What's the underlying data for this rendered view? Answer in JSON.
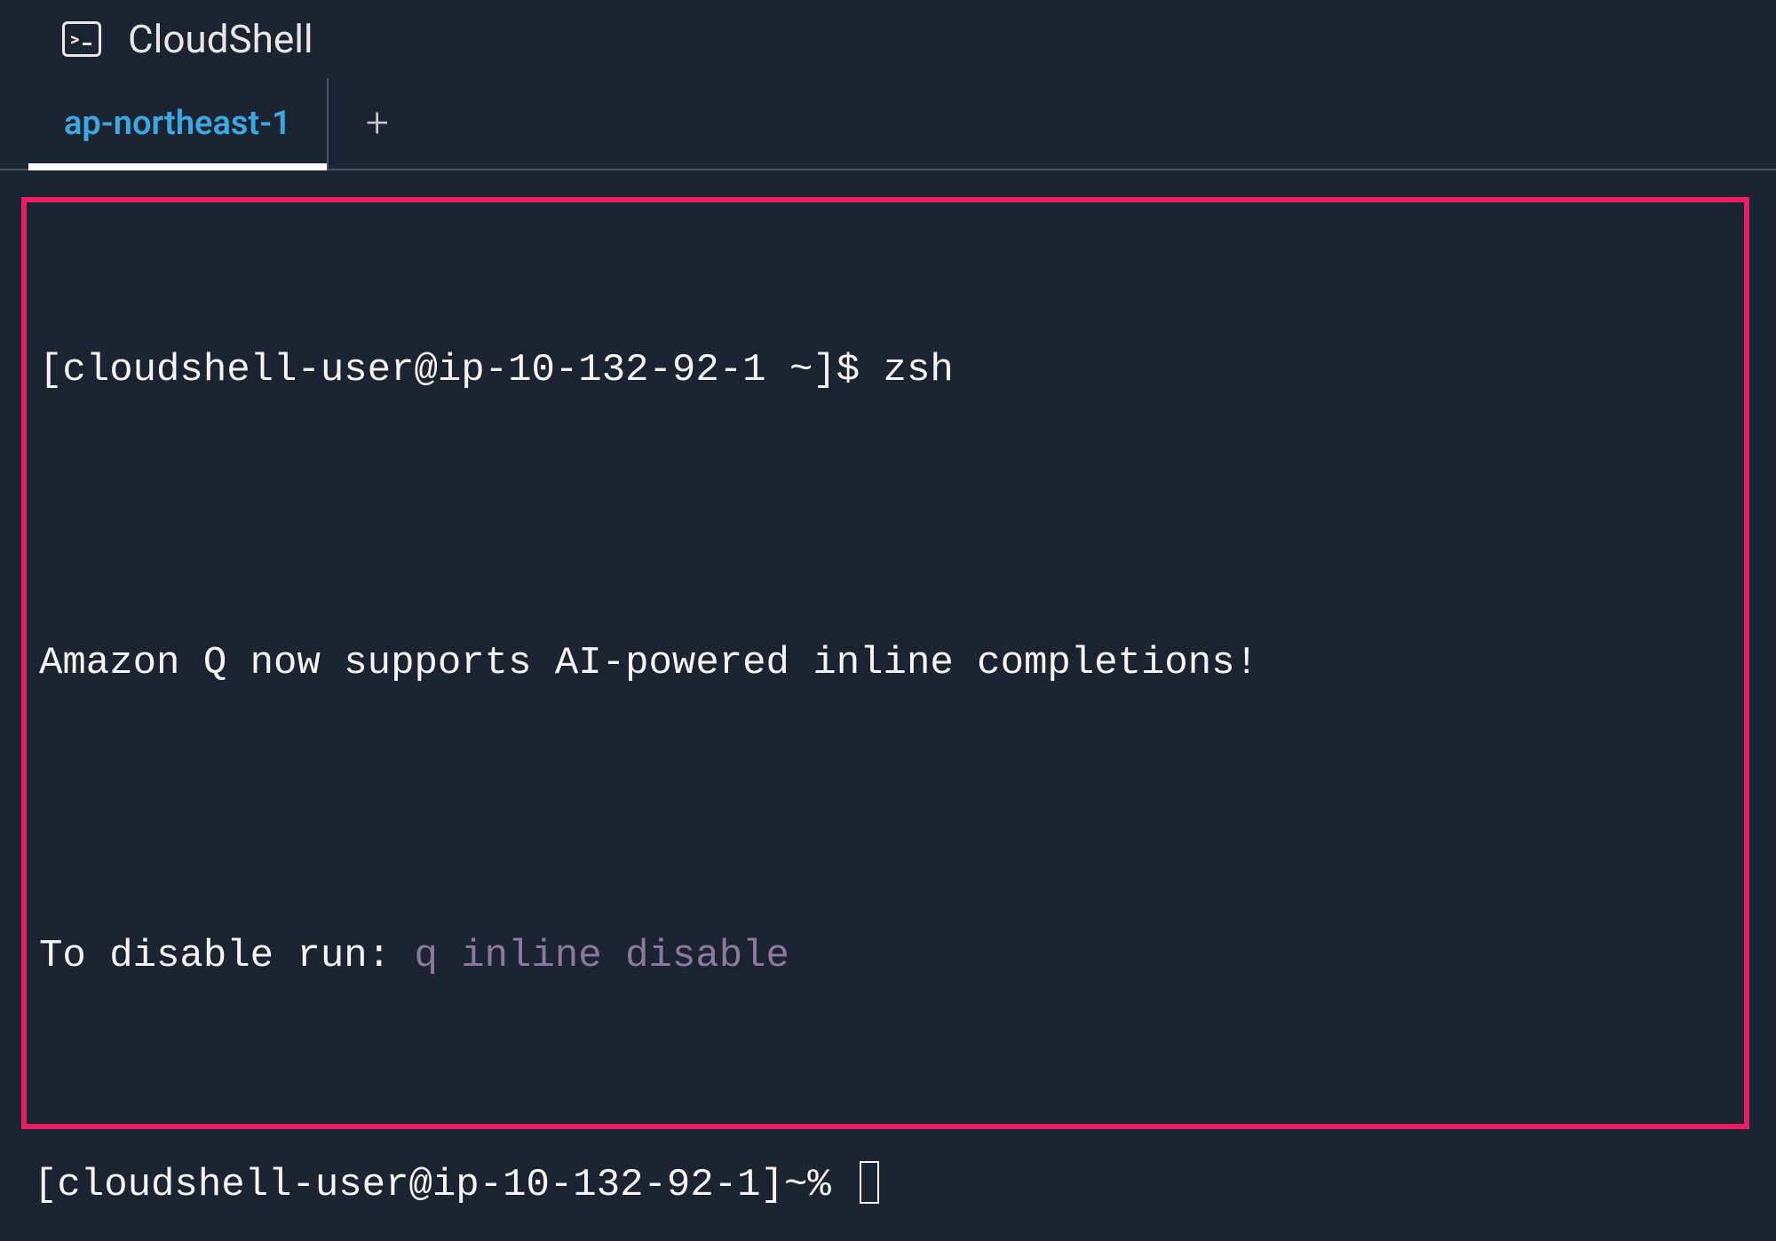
{
  "header": {
    "title": "CloudShell"
  },
  "tabs": {
    "active_label": "ap-northeast-1",
    "add_symbol": "+"
  },
  "terminal": {
    "line1_prompt": "[cloudshell-user@ip-10-132-92-1 ~]$ ",
    "line1_cmd": "zsh",
    "blank": "",
    "line2": "Amazon Q now supports AI-powered inline completions!",
    "line3_prefix": "To disable run: ",
    "line3_cmd": "q inline disable",
    "prompt2": "[cloudshell-user@ip-10-132-92-1]~% "
  }
}
